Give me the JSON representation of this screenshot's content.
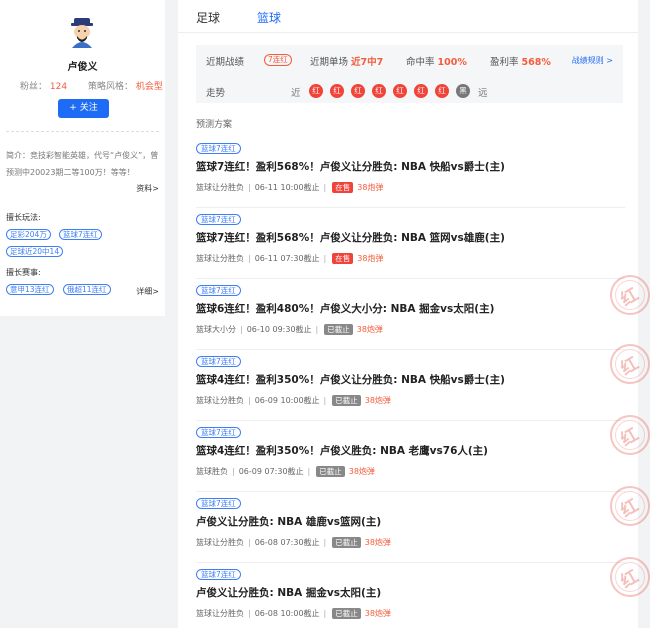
{
  "profile": {
    "name": "卢俊义",
    "fans_label": "粉丝：",
    "fans_value": "124",
    "style_label": "策略风格：",
    "style_value": "机会型",
    "follow_label": "+ 关注",
    "intro": "简介：竞技彩智能英雄，代号“卢俊义”，曾预测中20023期二等100万！等等！",
    "intro_more": "资料>",
    "skill_title": "擅长玩法:",
    "skill_tags": [
      "足彩204万",
      "篮球7连红",
      "足球近20中14"
    ],
    "league_title": "擅长赛事:",
    "league_tags": [
      "意甲13连红",
      "俄超11连红"
    ],
    "league_more": "详细>"
  },
  "tabs": [
    "足球",
    "篮球"
  ],
  "stat_box": {
    "record_label": "近期战绩",
    "record_badge": "7连红",
    "single_label": "近期单场",
    "single_value": "近7中7",
    "hit_label": "命中率",
    "hit_value": "100%",
    "profit_label": "盈利率",
    "profit_value": "568%",
    "rule_link": "战绩规则 >",
    "trend_label": "走势",
    "near_label": "近",
    "far_label": "远",
    "trend": [
      "红",
      "红",
      "红",
      "红",
      "红",
      "红",
      "红",
      "黑"
    ]
  },
  "section_title": "预测方案",
  "predictions": [
    {
      "tag": "篮球7连红",
      "title": "篮球7连红！盈利568%！卢俊义让分胜负: NBA 快船vs爵士(主)",
      "type": "篮球让分胜负",
      "time": "06-11 10:00截止",
      "status": "在售",
      "price": "38炮弹"
    },
    {
      "tag": "篮球7连红",
      "title": "篮球7连红！盈利568%！卢俊义让分胜负: NBA 篮网vs雄鹿(主)",
      "type": "篮球让分胜负",
      "time": "06-11 07:30截止",
      "status": "在售",
      "price": "38炮弹"
    },
    {
      "tag": "篮球7连红",
      "title": "篮球6连红！盈利480%！卢俊义大小分: NBA 掘金vs太阳(主)",
      "type": "篮球大小分",
      "time": "06-10 09:30截止",
      "status": "已截止",
      "price": "38炮弹"
    },
    {
      "tag": "篮球7连红",
      "title": "篮球4连红！盈利350%！卢俊义让分胜负: NBA 快船vs爵士(主)",
      "type": "篮球让分胜负",
      "time": "06-09 10:00截止",
      "status": "已截止",
      "price": "38炮弹"
    },
    {
      "tag": "篮球7连红",
      "title": "篮球4连红！盈利350%！卢俊义胜负: NBA 老鹰vs76人(主)",
      "type": "篮球胜负",
      "time": "06-09 07:30截止",
      "status": "已截止",
      "price": "38炮弹"
    },
    {
      "tag": "篮球7连红",
      "title": "卢俊义让分胜负: NBA 雄鹿vs篮网(主)",
      "type": "篮球让分胜负",
      "time": "06-08 07:30截止",
      "status": "已截止",
      "price": "38炮弹"
    },
    {
      "tag": "篮球7连红",
      "title": "卢俊义让分胜负: NBA 掘金vs太阳(主)",
      "type": "篮球让分胜负",
      "time": "06-08 10:00截止",
      "status": "已截止",
      "price": "38炮弹"
    }
  ],
  "stamp_text": "红",
  "colors": {
    "accent": "#1e6bf5",
    "red": "#f0433a",
    "gray_status": "#888888"
  }
}
